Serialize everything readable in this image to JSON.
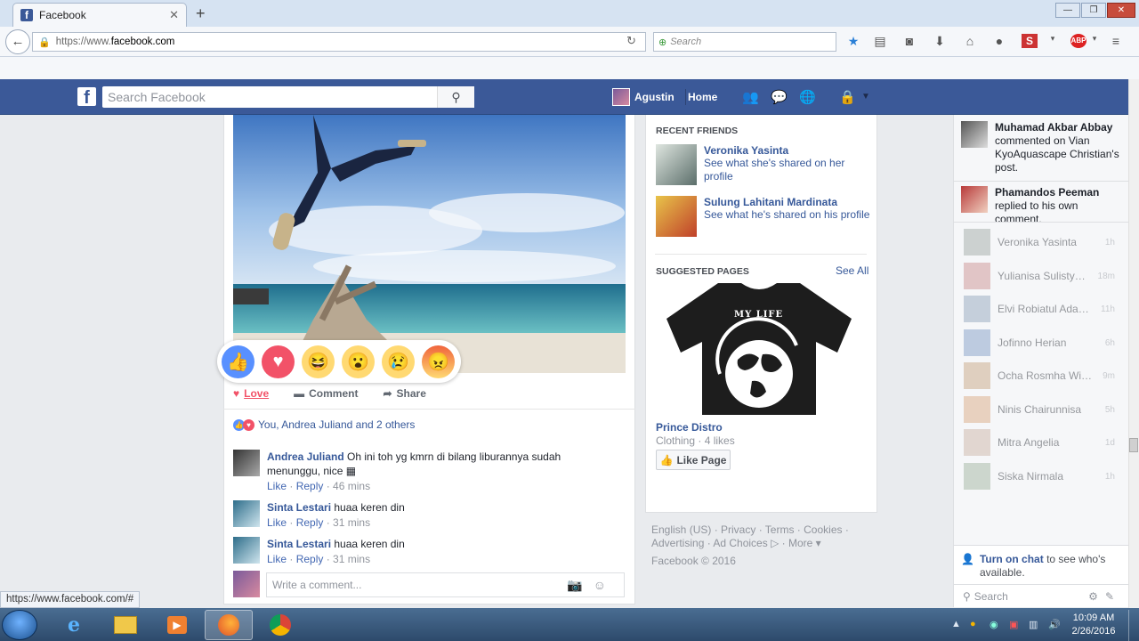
{
  "browser": {
    "tab_title": "Facebook",
    "url_prefix": "https://www.",
    "url_domain": "facebook.com",
    "search_placeholder": "Search",
    "status_url": "https://www.facebook.com/#"
  },
  "fb_header": {
    "search_placeholder": "Search Facebook",
    "user_name": "Agustin",
    "home_label": "Home"
  },
  "post": {
    "actions": {
      "love": "Love",
      "comment": "Comment",
      "share": "Share"
    },
    "reactions_summary": "You, Andrea Juliand and 2 others",
    "comments": [
      {
        "name": "Andrea Juliand",
        "text": "Oh ini toh yg kmrn di bilang liburannya sudah menunggu, nice",
        "like": "Like",
        "reply": "Reply",
        "time": "46 mins"
      },
      {
        "name": "Sinta Lestari",
        "text": "huaa keren din",
        "like": "Like",
        "reply": "Reply",
        "time": "31 mins"
      },
      {
        "name": "Sinta Lestari",
        "text": "huaa keren din",
        "like": "Like",
        "reply": "Reply",
        "time": "31 mins"
      }
    ],
    "write_placeholder": "Write a comment..."
  },
  "right": {
    "recent_friends_title": "RECENT FRIENDS",
    "friends": [
      {
        "name": "Veronika Yasinta",
        "sub": "See what she's shared on her profile"
      },
      {
        "name": "Sulung Lahitani Mardinata",
        "sub": "See what he's shared on his profile"
      }
    ],
    "suggested_title": "SUGGESTED PAGES",
    "see_all": "See All",
    "shirt_text": "MY LIFE",
    "page_name": "Prince Distro",
    "page_sub": "Clothing · 4 likes",
    "like_page": "Like Page",
    "footer_line1": "English (US) · Privacy · Terms · Cookies ·",
    "footer_line2": "Advertising · Ad Choices ▷ · More ▾",
    "footer_copy": "Facebook © 2016"
  },
  "ticker": [
    {
      "name": "Muhamad Akbar Abbay",
      "text": "commented on Vian KyoAquascape Christian's post."
    },
    {
      "name": "Phamandos Peeman",
      "text": "replied to his own comment."
    }
  ],
  "chat": [
    {
      "name": "Veronika Yasinta",
      "time": "1h"
    },
    {
      "name": "Yulianisa Sulistyoni...",
      "time": "18m"
    },
    {
      "name": "Elvi Robiatul Adawi...",
      "time": "11h"
    },
    {
      "name": "Jofinno Herian",
      "time": "6h"
    },
    {
      "name": "Ocha Rosmha Widy...",
      "time": "9m"
    },
    {
      "name": "Ninis Chairunnisa",
      "time": "5h"
    },
    {
      "name": "Mitra Angelia",
      "time": "1d"
    },
    {
      "name": "Siska Nirmala",
      "time": "1h"
    }
  ],
  "chat_bar": {
    "turn_on": "Turn on chat",
    "turn_on_rest": " to see who's available.",
    "search_placeholder": "Search"
  },
  "taskbar": {
    "time": "10:09 AM",
    "date": "2/26/2016"
  }
}
